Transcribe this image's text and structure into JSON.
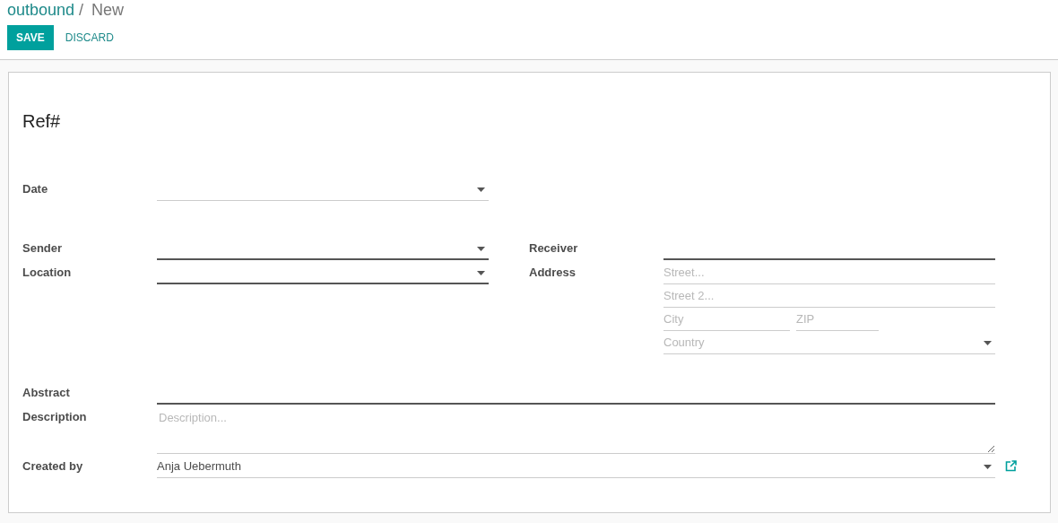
{
  "breadcrumb": [
    {
      "label": "outbound",
      "kind": "link"
    },
    {
      "label": "/",
      "kind": "separator"
    },
    {
      "label": "New",
      "kind": "current"
    }
  ],
  "buttons": [
    {
      "label": "SAVE",
      "kind": "primary"
    },
    {
      "label": "DISCARD",
      "kind": "link"
    }
  ],
  "form": {
    "title": "Ref#",
    "date": {
      "label": "Date",
      "kind": "select",
      "required": false
    },
    "left": [
      {
        "label": "Sender",
        "kind": "select",
        "required": true
      },
      {
        "label": "Location",
        "kind": "select",
        "required": true
      }
    ],
    "receiver": {
      "label": "Receiver",
      "kind": "text",
      "required": true
    },
    "address": {
      "label": "Address",
      "lines": [
        [
          {
            "kind": "text",
            "placeholder": "Street..."
          }
        ],
        [
          {
            "kind": "text",
            "placeholder": "Street 2..."
          }
        ],
        [
          {
            "kind": "text",
            "placeholder": "City"
          },
          {
            "kind": "text",
            "placeholder": "ZIP"
          }
        ],
        [
          {
            "kind": "select",
            "placeholder": "Country"
          }
        ]
      ]
    },
    "bottom": [
      {
        "label": "Abstract",
        "kind": "text",
        "required": true
      },
      {
        "label": "Description",
        "kind": "textarea",
        "required": false,
        "placeholder": "Description..."
      },
      {
        "label": "Created by",
        "kind": "select",
        "required": false,
        "value": "Anja Uebermuth",
        "external_link": true
      }
    ]
  }
}
